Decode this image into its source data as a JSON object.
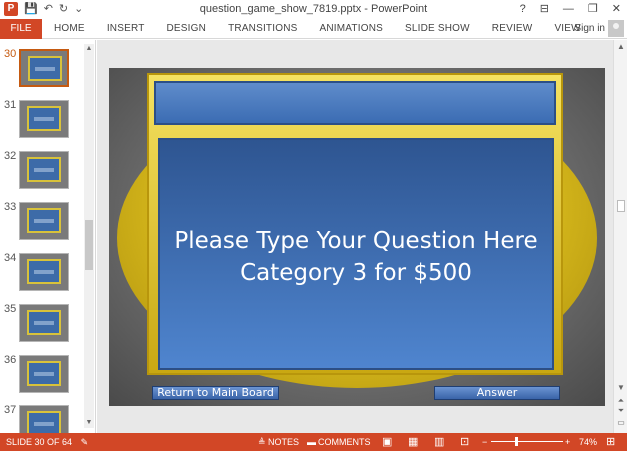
{
  "window": {
    "title": "question_game_show_7819.pptx - PowerPoint",
    "help": "?",
    "controls": [
      "⊟",
      "—",
      "❐",
      "✕"
    ]
  },
  "qat": {
    "save": "💾",
    "undo": "↶",
    "redo": "↻",
    "custom": "⌄"
  },
  "ribbon": {
    "file": "FILE",
    "tabs": [
      "HOME",
      "INSERT",
      "DESIGN",
      "TRANSITIONS",
      "ANIMATIONS",
      "SLIDE SHOW",
      "REVIEW",
      "VIEW"
    ],
    "signin": "Sign in"
  },
  "thumbnails": [
    {
      "num": "30",
      "active": true
    },
    {
      "num": "31",
      "active": false
    },
    {
      "num": "32",
      "active": false
    },
    {
      "num": "33",
      "active": false
    },
    {
      "num": "34",
      "active": false
    },
    {
      "num": "35",
      "active": false
    },
    {
      "num": "36",
      "active": false
    },
    {
      "num": "37",
      "active": false
    }
  ],
  "slide": {
    "question_line1": "Please Type Your Question Here",
    "question_line2": "Category 3 for $500",
    "return_button": "Return to Main Board",
    "answer_button": "Answer"
  },
  "status": {
    "slide_info": "SLIDE 30 OF 64",
    "notes": "NOTES",
    "comments": "COMMENTS",
    "zoom_minus": "−",
    "zoom_plus": "+",
    "zoom": "74%"
  },
  "colors": {
    "accent": "#d24726",
    "slide_blue": "#3b6cb3",
    "frame_gold": "#d6b81c"
  }
}
